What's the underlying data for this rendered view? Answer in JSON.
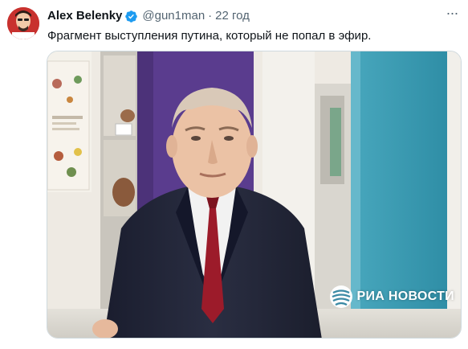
{
  "author": {
    "display_name": "Alex Belenky",
    "handle": "@gun1man",
    "separator": "·",
    "time": "22 год",
    "verified_color": "#1d9bf0"
  },
  "tweet": {
    "text": "Фрагмент выступления путина, который не попал в эфир."
  },
  "more_menu": {
    "icon": "more-horizontal-icon",
    "glyph": "···"
  },
  "media": {
    "type": "video-frame",
    "watermark": "РИА НОВОСТИ"
  },
  "colors": {
    "text": "#0f1419",
    "secondary": "#536471",
    "border": "#cfd9de",
    "verified": "#1d9bf0"
  }
}
